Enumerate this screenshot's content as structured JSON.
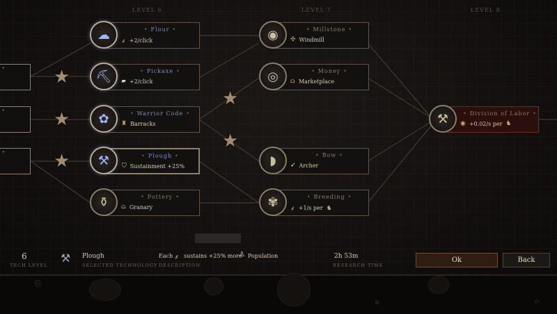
{
  "levels": [
    "Level 6",
    "Level 7",
    "Level 8"
  ],
  "nodes": {
    "flour": {
      "title": "Flour",
      "sub": "+2/click",
      "icon": "grain-icon",
      "sub_icon": "wheat-icon"
    },
    "pickaxe": {
      "title": "Pickaxe",
      "sub": "+2/click",
      "icon": "pickaxe-icon",
      "sub_icon": "stone-icon"
    },
    "warrior": {
      "title": "Warrior Code",
      "sub": "Barracks",
      "icon": "warrior-icon",
      "sub_icon": "building-icon"
    },
    "plough": {
      "title": "Plough",
      "sub": "Sustainment +25%",
      "icon": "plough-icon",
      "sub_icon": "shield-icon"
    },
    "pottery": {
      "title": "Pottery",
      "sub": "Granary",
      "icon": "vase-icon",
      "sub_icon": "granary-icon"
    },
    "millstone": {
      "title": "Millstone",
      "sub": "Windmill",
      "icon": "millstone-icon",
      "sub_icon": "windmill-icon"
    },
    "money": {
      "title": "Money",
      "sub": "Marketplace",
      "icon": "coin-icon",
      "sub_icon": "market-icon"
    },
    "bow": {
      "title": "Bow",
      "sub": "Archer",
      "icon": "bow-icon",
      "sub_icon": "archer-icon"
    },
    "breeding": {
      "title": "Breeding",
      "sub": "+1/s per",
      "icon": "breeding-icon",
      "sub_icon": "wheat-icon"
    },
    "labor": {
      "title": "Division of Labor",
      "sub": "+0.02/s per",
      "icon": "tools-icon",
      "sub_icon": "coin-icon"
    }
  },
  "footer": {
    "tech_level_value": "6",
    "tech_level_label": "Tech Level",
    "selected_name": "Plough",
    "selected_label": "Selected Technology",
    "desc_each": "Each",
    "desc_mid": "sustains +25% more",
    "desc_end": "Population",
    "desc_label": "Description",
    "time_value": "2h 53m",
    "time_label": "Research time"
  },
  "buttons": {
    "ok": "Ok",
    "back": "Back"
  },
  "colors": {
    "accent": "#8b8272",
    "final_node": "#2a0f0c",
    "ok_button": "#2f1d14"
  }
}
